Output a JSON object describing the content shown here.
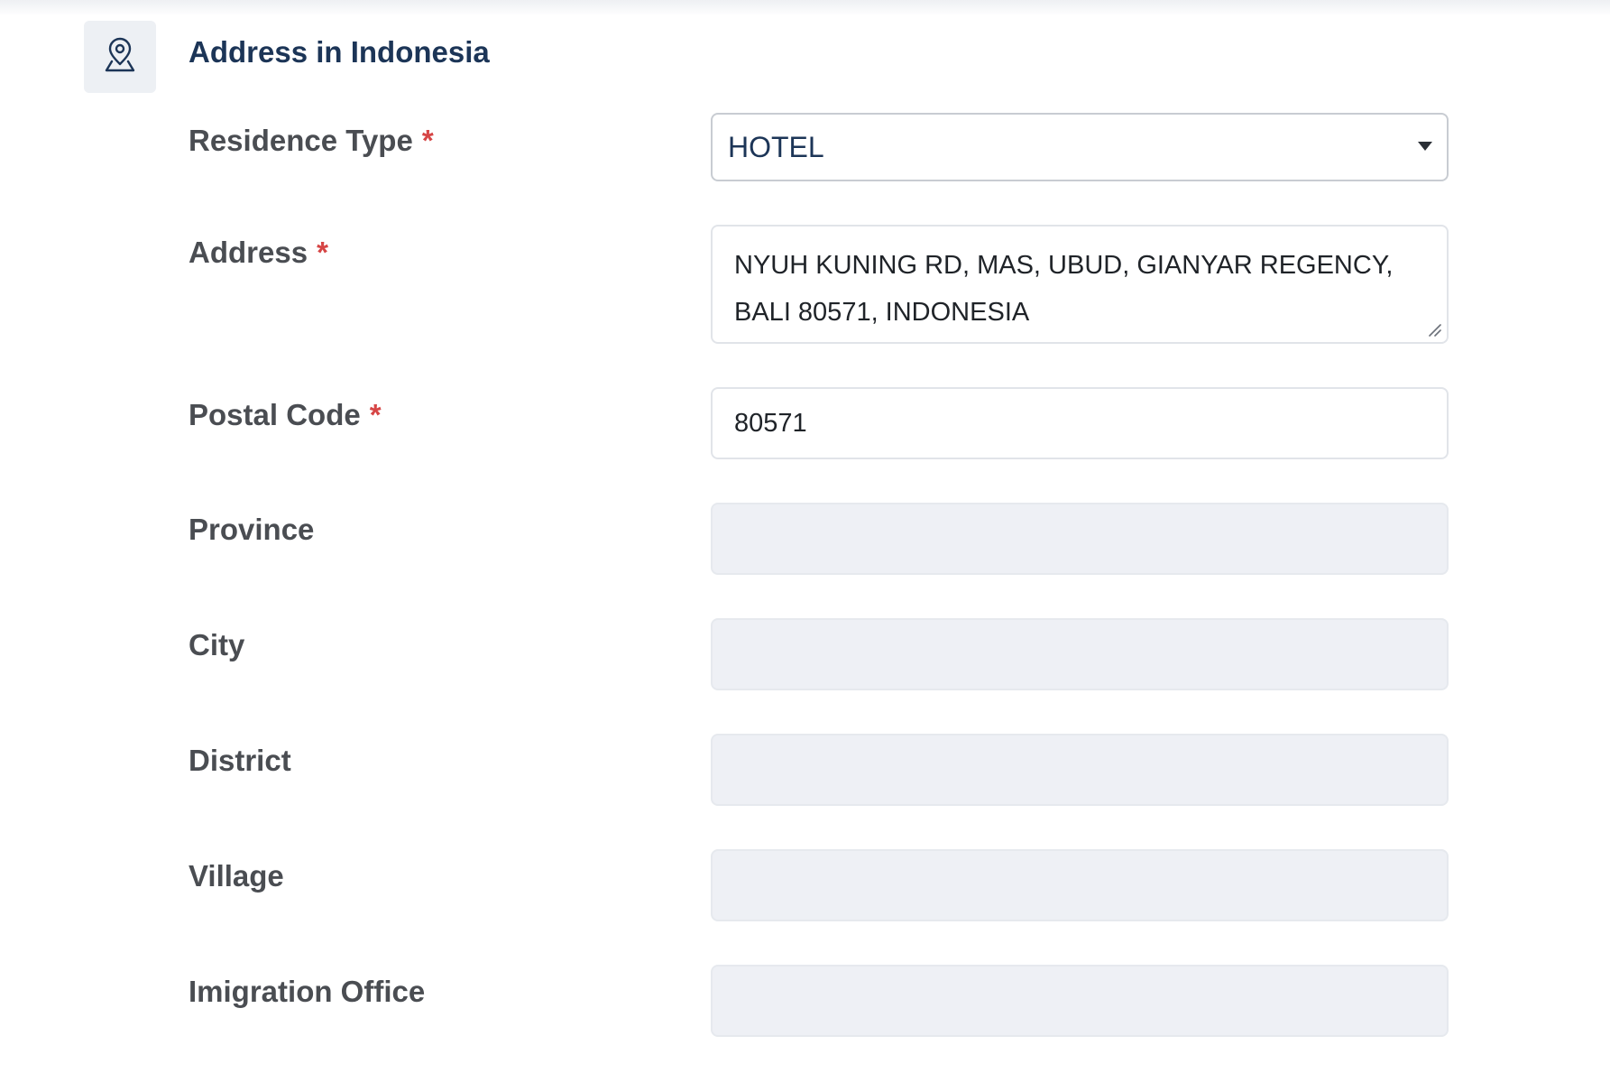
{
  "section": {
    "icon": "map-pin-icon",
    "title": "Address in Indonesia"
  },
  "colors": {
    "title": "#1c3557",
    "label": "#4a4d52",
    "required": "#d64545",
    "disabled_bg": "#eef0f5",
    "icon_bg": "#edf0f4"
  },
  "required_marker": "*",
  "fields": {
    "residence_type": {
      "label": "Residence Type",
      "value": "HOTEL"
    },
    "address": {
      "label": "Address",
      "value": "NYUH KUNING RD, MAS, UBUD, GIANYAR REGENCY, BALI 80571, INDONESIA"
    },
    "postal_code": {
      "label": "Postal Code",
      "value": "80571"
    },
    "province": {
      "label": "Province",
      "value": ""
    },
    "city": {
      "label": "City",
      "value": ""
    },
    "district": {
      "label": "District",
      "value": ""
    },
    "village": {
      "label": "Village",
      "value": ""
    },
    "imigration_office": {
      "label": "Imigration Office",
      "value": ""
    }
  }
}
